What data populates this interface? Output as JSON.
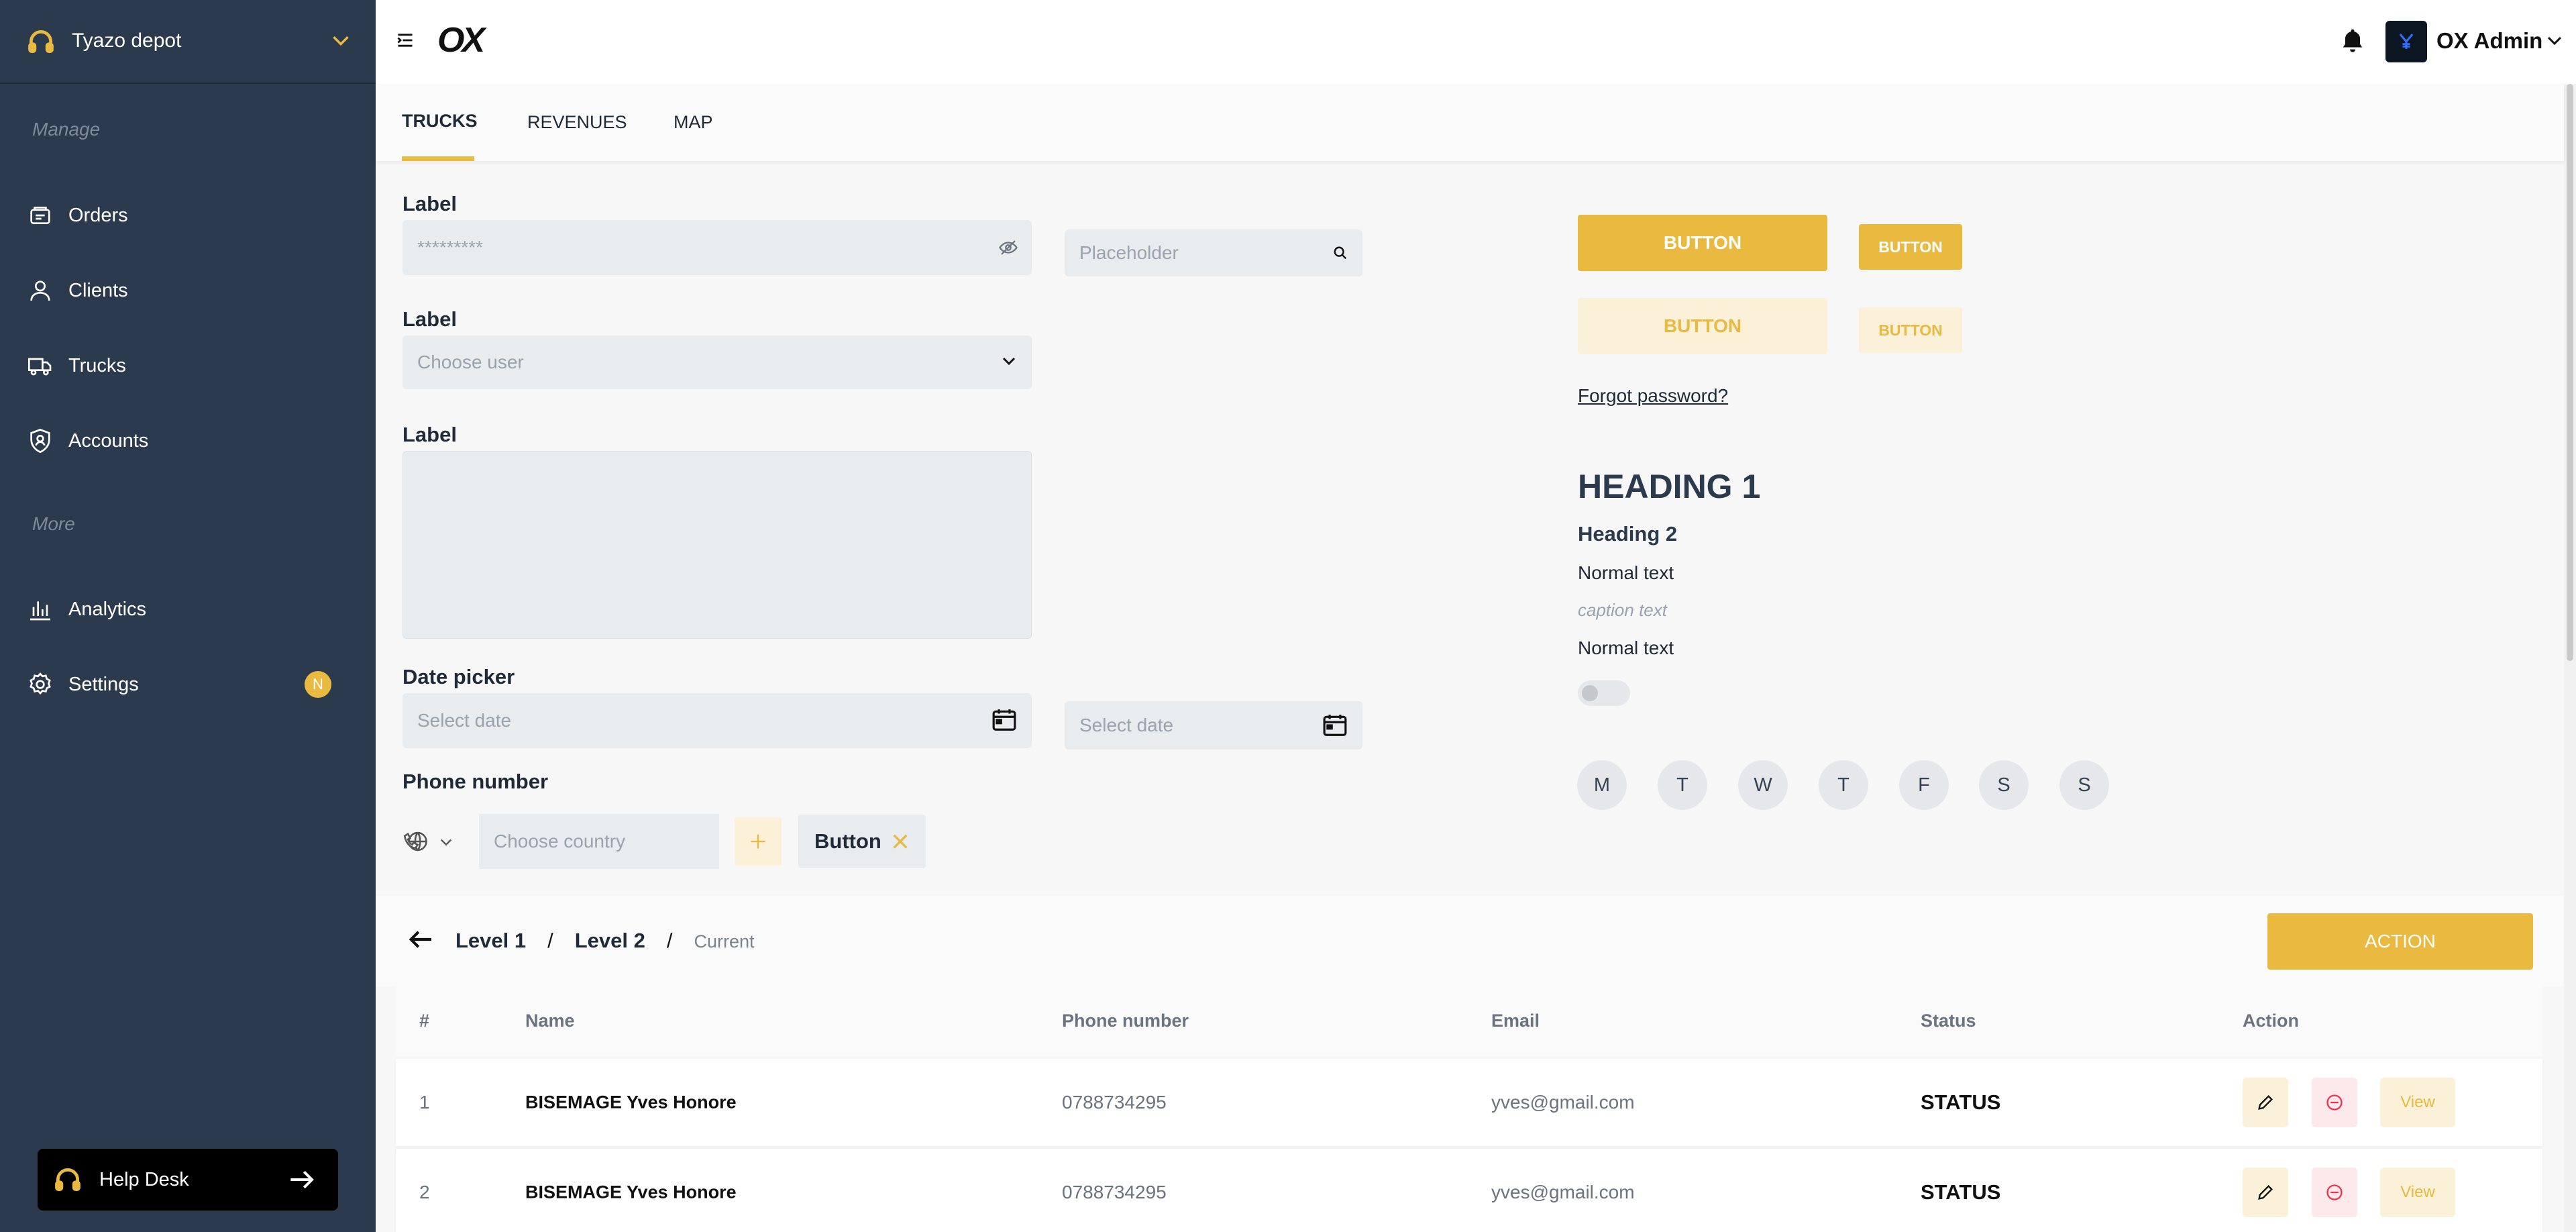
{
  "sidebar": {
    "depot_name": "Tyazo depot",
    "section_manage": "Manage",
    "section_more": "More",
    "items": [
      {
        "label": "Orders",
        "icon": "orders-icon"
      },
      {
        "label": "Clients",
        "icon": "user-icon"
      },
      {
        "label": "Trucks",
        "icon": "truck-icon"
      },
      {
        "label": "Accounts",
        "icon": "shield-user-icon"
      },
      {
        "label": "Analytics",
        "icon": "bar-chart-icon"
      },
      {
        "label": "Settings",
        "icon": "gear-icon"
      }
    ],
    "settings_badge": "N",
    "help_desk": "Help Desk"
  },
  "topbar": {
    "logo": "OX",
    "user_name": "OX Admin"
  },
  "tabs": [
    "TRUCKS",
    "REVENUES",
    "MAP"
  ],
  "form": {
    "label1": "Label",
    "password_placeholder": "*********",
    "label2": "Label",
    "select_placeholder": "Choose user",
    "label3": "Label",
    "search_placeholder": "Placeholder",
    "date_label": "Date picker",
    "date_placeholder": "Select date",
    "date_placeholder2": "Select date",
    "phone_label": "Phone number",
    "country_placeholder": "Choose country",
    "chip_label": "Button"
  },
  "buttons": {
    "large_primary": "BUTTON",
    "small_primary": "BUTTON",
    "large_light": "BUTTON",
    "small_light": "BUTTON",
    "forgot": "Forgot password?"
  },
  "typography": {
    "h1": "HEADING 1",
    "h2": "Heading 2",
    "normal1": "Normal text",
    "caption": "caption text",
    "normal2": "Normal text"
  },
  "days": [
    "M",
    "T",
    "W",
    "T",
    "F",
    "S",
    "S"
  ],
  "breadcrumb": {
    "level1": "Level 1",
    "sep": "/",
    "level2": "Level 2",
    "current": "Current"
  },
  "action_label": "ACTION",
  "table": {
    "headers": [
      "#",
      "Name",
      "Phone number",
      "Email",
      "Status",
      "Action"
    ],
    "rows": [
      {
        "num": "1",
        "name": "BISEMAGE Yves Honore",
        "phone": "0788734295",
        "email": "yves@gmail.com",
        "status": "STATUS",
        "view": "View"
      },
      {
        "num": "2",
        "name": "BISEMAGE Yves Honore",
        "phone": "0788734295",
        "email": "yves@gmail.com",
        "status": "STATUS",
        "view": "View"
      }
    ]
  },
  "colors": {
    "accent": "#e9b940",
    "sidebar": "#2b3a4d"
  }
}
